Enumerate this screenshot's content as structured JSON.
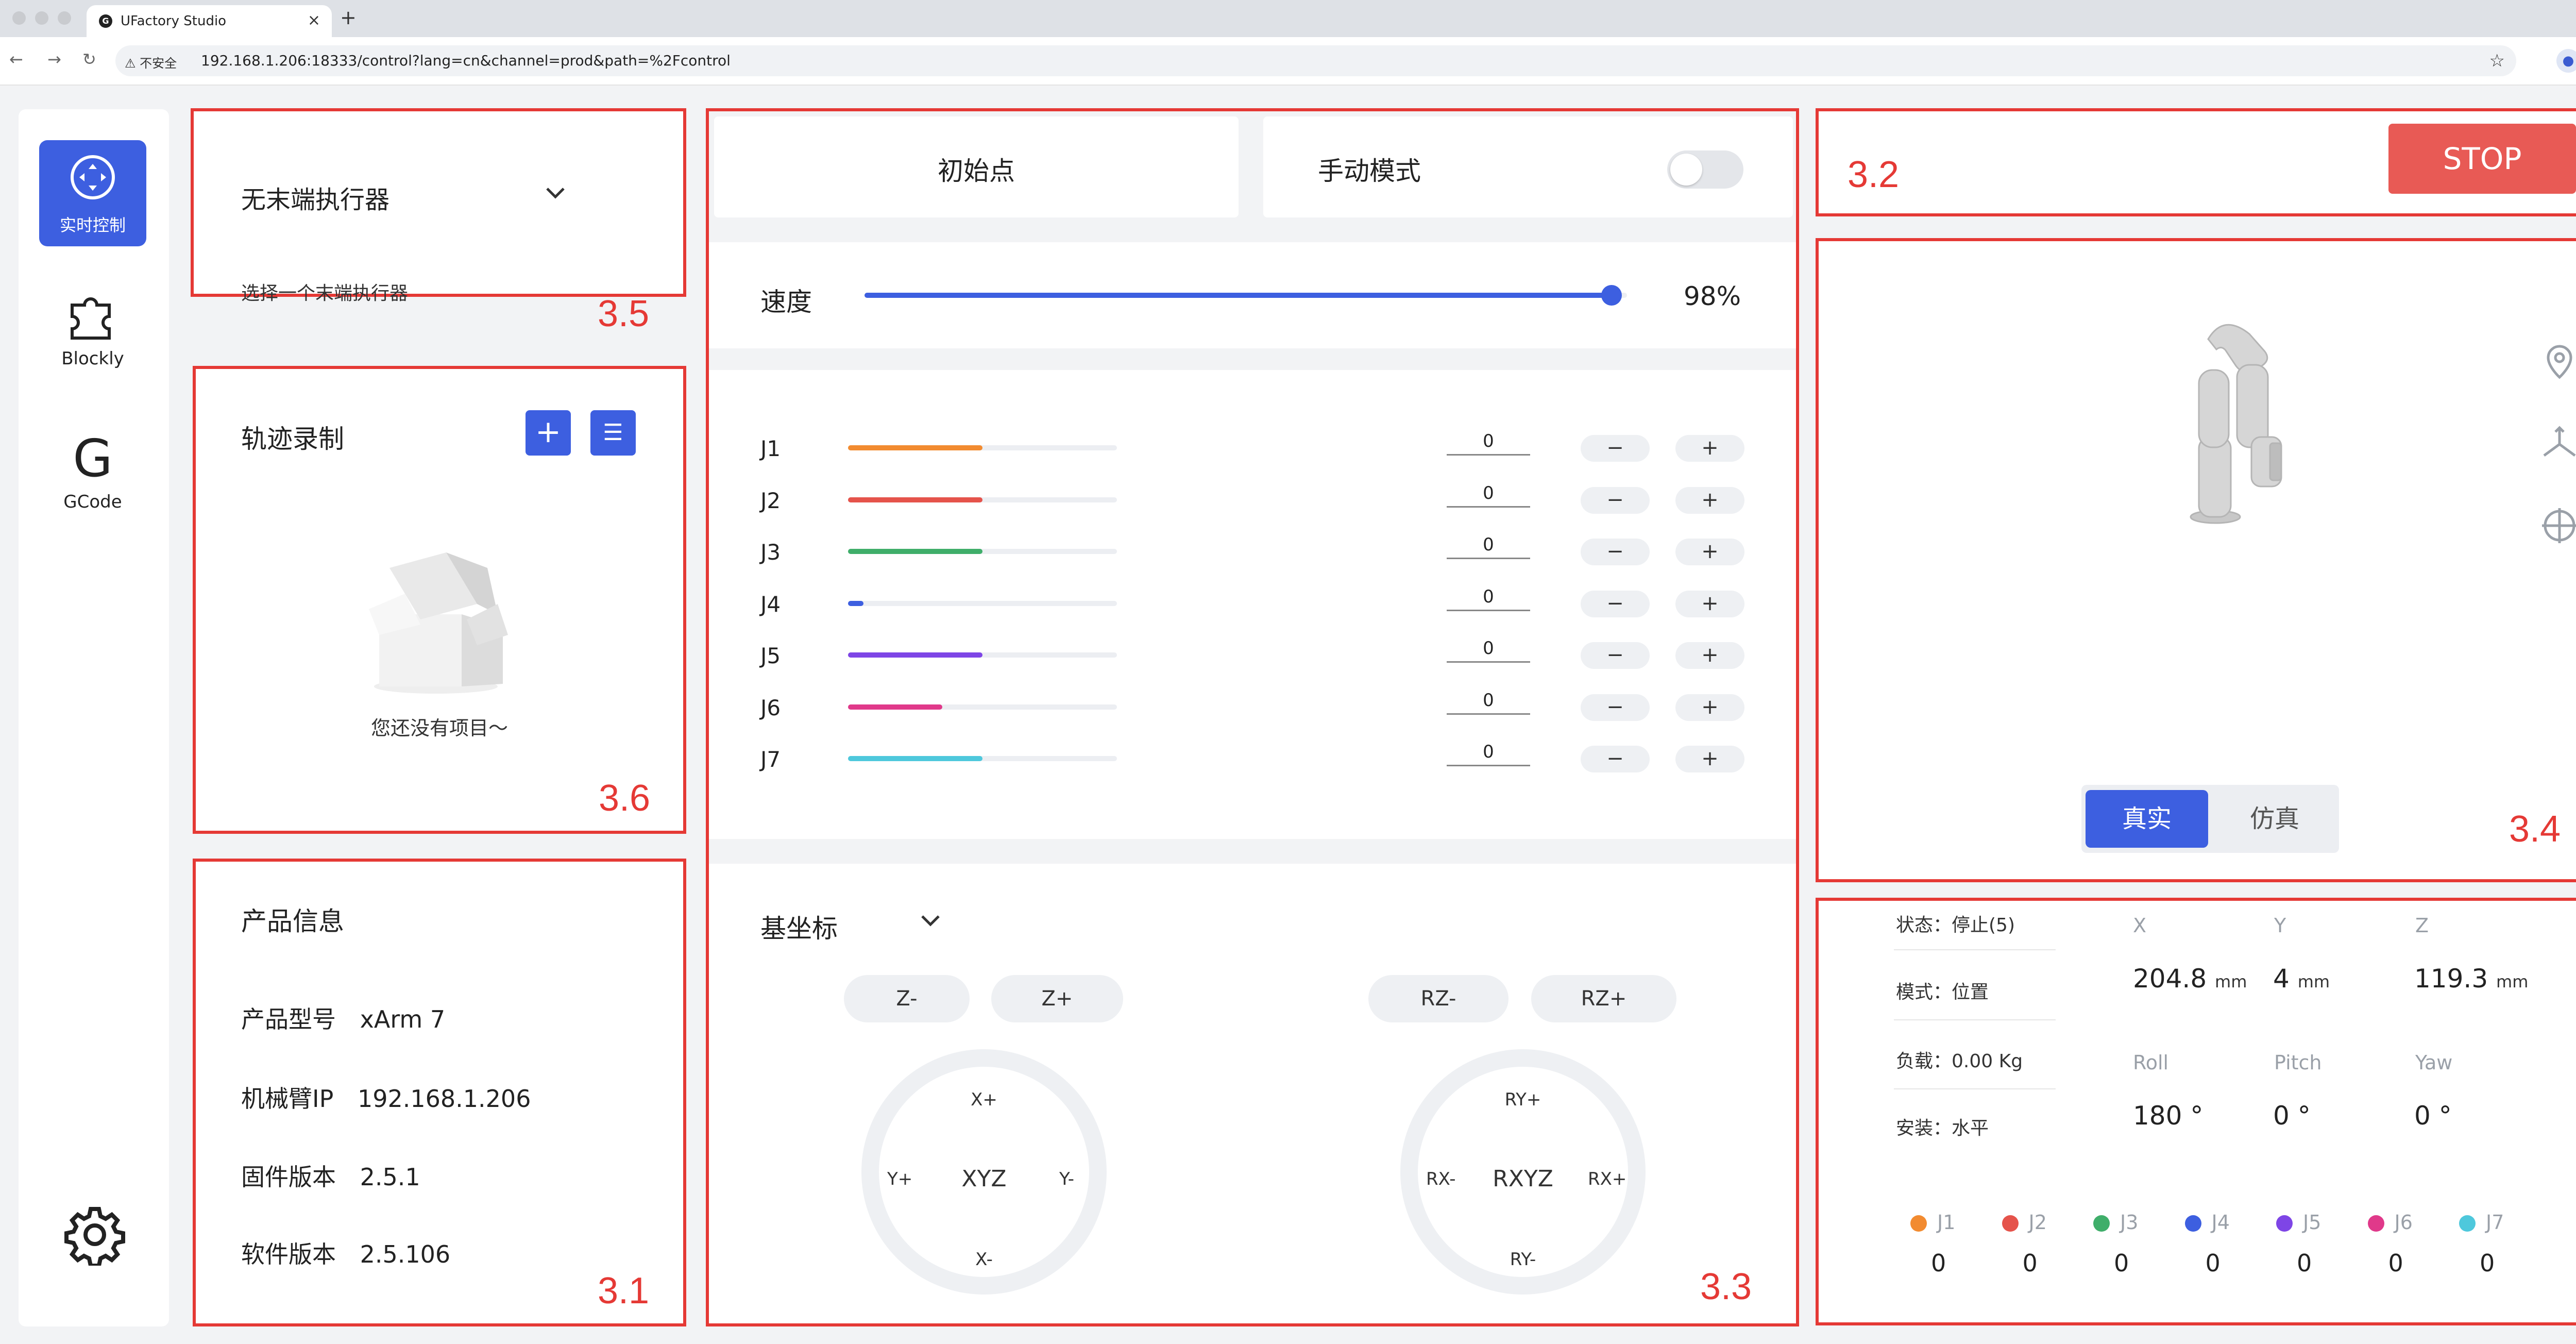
{
  "browser": {
    "tab_title": "UFactory Studio",
    "favicon": "G",
    "new_tab": "+",
    "tab_close": "×",
    "tab_menu": "⌄",
    "insecure_label": "不安全",
    "url": "192.168.1.206:18333/control?lang=cn&channel=prod&path=%2Fcontrol"
  },
  "sidebar": {
    "items": [
      {
        "label": "实时控制",
        "icon": "gamepad-icon"
      },
      {
        "label": "Blockly",
        "icon": "puzzle-icon"
      },
      {
        "label": "GCode",
        "icon": "gcode-icon",
        "glyph": "G"
      }
    ],
    "settings_icon": "gear-icon"
  },
  "end_effector": {
    "title": "无末端执行器",
    "subtitle": "选择一个末端执行器",
    "tag": "3.5"
  },
  "trajectory": {
    "title": "轨迹录制",
    "add_glyph": "+",
    "list_glyph": "☰",
    "empty_text": "您还没有项目～",
    "tag": "3.6"
  },
  "product": {
    "title": "产品信息",
    "rows": [
      {
        "label": "产品型号",
        "value": "xArm 7"
      },
      {
        "label": "机械臂IP",
        "value": "192.168.1.206"
      },
      {
        "label": "固件版本",
        "value": "2.5.1"
      },
      {
        "label": "软件版本",
        "value": "2.5.106"
      }
    ],
    "tag": "3.1"
  },
  "control": {
    "home_label": "初始点",
    "manual_mode_label": "手动模式",
    "manual_mode_on": false,
    "speed_label": "速度",
    "speed_percent": 98,
    "speed_text": "98%",
    "minus": "−",
    "plus": "+",
    "joints": [
      {
        "name": "J1",
        "value": "0",
        "fraction": 0.5,
        "color": "#f28b30"
      },
      {
        "name": "J2",
        "value": "0",
        "fraction": 0.5,
        "color": "#e5534b"
      },
      {
        "name": "J3",
        "value": "0",
        "fraction": 0.5,
        "color": "#3fae6a"
      },
      {
        "name": "J4",
        "value": "0",
        "fraction": 0.02,
        "color": "#3d5fe0"
      },
      {
        "name": "J5",
        "value": "0",
        "fraction": 0.5,
        "color": "#7e45e6"
      },
      {
        "name": "J6",
        "value": "0",
        "fraction": 0.35,
        "color": "#e0398a"
      },
      {
        "name": "J7",
        "value": "0",
        "fraction": 0.5,
        "color": "#4ec8dc"
      }
    ],
    "coord_label": "基坐标",
    "xyz": {
      "zminus": "Z-",
      "zplus": "Z+",
      "center": "XYZ",
      "top": "X+",
      "bottom": "X-",
      "left": "Y+",
      "right": "Y-"
    },
    "rxyz": {
      "rzminus": "RZ-",
      "rzplus": "RZ+",
      "center": "RXYZ",
      "top": "RY+",
      "bottom": "RY-",
      "left": "RX-",
      "right": "RX+"
    },
    "tag": "3.3"
  },
  "stop": {
    "label": "STOP",
    "tag": "3.2"
  },
  "viewer": {
    "real_label": "真实",
    "sim_label": "仿真",
    "tag": "3.4"
  },
  "status": {
    "rows": [
      {
        "label": "状态：停止(5)"
      },
      {
        "label": "模式：位置"
      },
      {
        "label": "负载：0.00 Kg"
      },
      {
        "label": "安装：水平"
      }
    ],
    "position": [
      {
        "name": "X",
        "value": "204.8",
        "unit": "mm"
      },
      {
        "name": "Y",
        "value": "4",
        "unit": "mm"
      },
      {
        "name": "Z",
        "value": "119.3",
        "unit": "mm"
      }
    ],
    "orientation": [
      {
        "name": "Roll",
        "value": "180 °"
      },
      {
        "name": "Pitch",
        "value": "0 °"
      },
      {
        "name": "Yaw",
        "value": "0 °"
      }
    ],
    "joints": [
      {
        "name": "J1",
        "value": "0",
        "color": "#f28b30"
      },
      {
        "name": "J2",
        "value": "0",
        "color": "#e5534b"
      },
      {
        "name": "J3",
        "value": "0",
        "color": "#3fae6a"
      },
      {
        "name": "J4",
        "value": "0",
        "color": "#3d5fe0"
      },
      {
        "name": "J5",
        "value": "0",
        "color": "#7e45e6"
      },
      {
        "name": "J6",
        "value": "0",
        "color": "#e0398a"
      },
      {
        "name": "J7",
        "value": "0",
        "color": "#4ec8dc"
      }
    ]
  },
  "colors": {
    "accent": "#3d5fe0",
    "annotation": "#e53935",
    "stop": "#e85a55"
  }
}
